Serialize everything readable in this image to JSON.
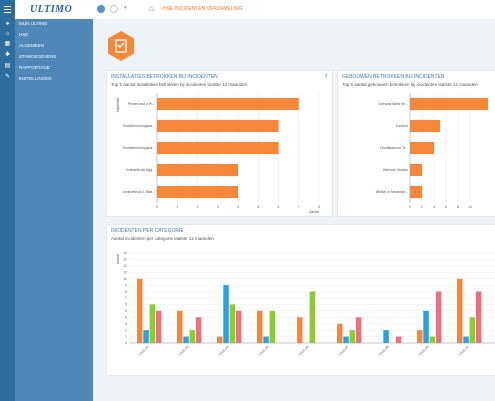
{
  "app": {
    "logo": "ULTIMO",
    "breadcrumb": "HSE INCIDENTEN VERZAMELING"
  },
  "sidebar_icons": [
    "user-icon",
    "home-icon",
    "grid-icon",
    "settings-icon",
    "doc-icon",
    "wrench-icon"
  ],
  "menu": {
    "items": [
      "MIJN ULTIMO",
      "HSE",
      "ALGEMEEN",
      "STAMGEGEVENS",
      "RAPPORTAGE",
      "INSTELLINGEN"
    ]
  },
  "colors": {
    "orange": "#f5873a",
    "blue": "#29a2e2",
    "green": "#8ccd2b",
    "pink": "#ef6e7b",
    "menu": "#4f87b8"
  },
  "chart_data": [
    {
      "type": "bar",
      "title": "INSTALLATIES BETROKKEN BIJ INCIDENTEN",
      "subtitle": "Top 5 aantal installaties betrokken bij incidenten laatste 12 maanden",
      "xlabel": "Aantal",
      "ylabel": "Installatie",
      "categories": [
        "Printer and a Pr...",
        "Hoofdbesturingska...",
        "Hoofdbesturingska...",
        "Vorkheftruck Agg...",
        "Vorkheftruck 1 Stat..."
      ],
      "values": [
        7,
        6,
        6,
        4,
        4
      ],
      "xlim": [
        0,
        8
      ],
      "xticks": [
        "0",
        "1",
        "2",
        "3",
        "4",
        "5",
        "6",
        "7",
        "8"
      ]
    },
    {
      "type": "bar",
      "title": "GEBOUWEN BETROKKEN BIJ INCIDENTEN",
      "subtitle": "Top 5 aantal gebouwen betrokken bij incidenten laatste 12 maanden",
      "categories": [
        "Gebouw West Ve...",
        "Kantoor",
        "Hoofdkantoor Tr...",
        "Gebouw Oosten",
        "Winkel in Nederlan..."
      ],
      "values": [
        13,
        5,
        4,
        2,
        2
      ],
      "xlim": [
        0,
        14
      ],
      "xticks": [
        "0",
        "2",
        "4",
        "6",
        "8",
        "10"
      ]
    },
    {
      "type": "bar",
      "title": "INCIDENTEN PER CATEGORIE",
      "subtitle": "Aantal incidenten per categorie laatste 12 maanden",
      "ylabel": "Aantal",
      "ylim": [
        0,
        14
      ],
      "yticks": [
        "0",
        "1",
        "2",
        "3",
        "4",
        "5",
        "6",
        "7",
        "8",
        "9",
        "10",
        "11",
        "12",
        "13",
        "14"
      ],
      "categories": [
        "2016-02",
        "2016-03",
        "2016-04",
        "2016-05",
        "2016-06",
        "2016-07",
        "2016-08",
        "2016-09",
        "2016-10"
      ],
      "series": [
        {
          "values": [
            10,
            5,
            1,
            5,
            4,
            3,
            0,
            2,
            10
          ]
        },
        {
          "values": [
            2,
            1,
            9,
            1,
            0,
            1,
            2,
            5,
            1
          ]
        },
        {
          "values": [
            6,
            2,
            6,
            5,
            8,
            2,
            0,
            1,
            4
          ]
        },
        {
          "values": [
            5,
            4,
            5,
            0,
            0,
            4,
            1,
            8,
            8
          ]
        }
      ]
    }
  ]
}
